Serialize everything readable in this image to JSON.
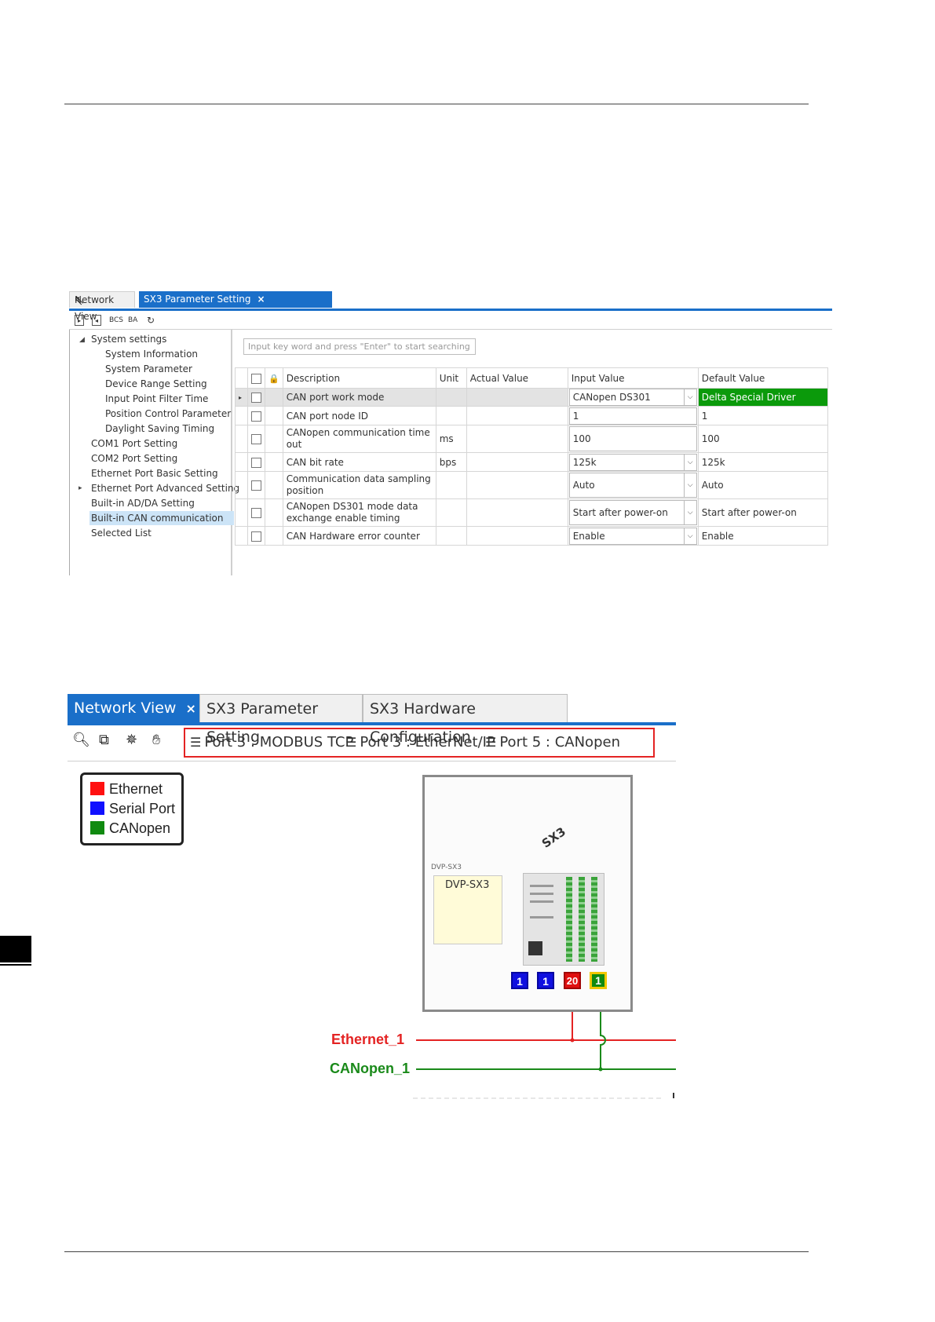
{
  "screenshot1": {
    "tabs": [
      {
        "label": "Network View"
      },
      {
        "label": "SX3 Parameter Setting",
        "close": "×"
      }
    ],
    "toolbar_icons": [
      "import-icon",
      "export-icon",
      "bcs-icon",
      "ba-icon",
      "refresh-icon"
    ],
    "toolbar_text": {
      "bcs": "BCS",
      "ba": "BA"
    },
    "tree": {
      "root": "System settings",
      "children": [
        "System Information",
        "System Parameter",
        "Device Range Setting",
        "Input Point Filter Time",
        "Position Control Parameter",
        "Daylight Saving Timing"
      ],
      "items": [
        "COM1 Port Setting",
        "COM2 Port Setting",
        "Ethernet Port Basic Setting",
        "Ethernet Port Advanced Setting",
        "Built-in AD/DA Setting",
        "Built-in CAN communication",
        "Selected List"
      ],
      "selected": "Built-in CAN communication"
    },
    "search": {
      "placeholder": "Input key word and press \"Enter\" to start searching"
    },
    "columns": {
      "description": "Description",
      "unit": "Unit",
      "actual": "Actual Value",
      "input": "Input Value",
      "default": "Default Value"
    },
    "rows": [
      {
        "desc": "CAN port work mode",
        "unit": "",
        "input": "CANopen DS301",
        "dropdown": true,
        "default": "Delta Special Driver"
      },
      {
        "desc": "CAN port node ID",
        "unit": "",
        "input": "1",
        "dropdown": false,
        "default": "1"
      },
      {
        "desc": "CANopen communication time out",
        "unit": "ms",
        "input": "100",
        "dropdown": false,
        "default": "100"
      },
      {
        "desc": "CAN bit rate",
        "unit": "bps",
        "input": "125k",
        "dropdown": true,
        "default": "125k"
      },
      {
        "desc": "Communication data sampling position",
        "unit": "",
        "input": "Auto",
        "dropdown": true,
        "default": "Auto"
      },
      {
        "desc": "CANopen DS301 mode data exchange enable timing",
        "unit": "",
        "input": "Start after power-on",
        "dropdown": true,
        "default": "Start after power-on"
      },
      {
        "desc": "CAN Hardware error counter",
        "unit": "",
        "input": "Enable",
        "dropdown": true,
        "default": "Enable"
      }
    ],
    "colors": {
      "accent": "#1a6fc9",
      "default_highlight": "#0b9a0b"
    }
  },
  "screenshot2": {
    "tabs": [
      {
        "label": "Network View",
        "close": "×"
      },
      {
        "label": "SX3 Parameter Setting"
      },
      {
        "label": "SX3 Hardware Configuration"
      }
    ],
    "toolbar_icons": [
      "zoom-fit-icon",
      "zoom-select-icon",
      "network-icon",
      "hand-icon"
    ],
    "ports": [
      "Port 3 : MODBUS TCP",
      "Port 3 : EtherNet/IP",
      "Port 5 : CANopen"
    ],
    "legend": [
      {
        "label": "Ethernet",
        "color": "#ff1010"
      },
      {
        "label": "Serial Port",
        "color": "#1010ff"
      },
      {
        "label": "CANopen",
        "color": "#108a10"
      }
    ],
    "device": {
      "rotated_label": "SX3",
      "small_label": "DVP-SX3",
      "module_label": "DVP-SX3"
    },
    "port_badges": [
      {
        "label": "1",
        "color": "#1010e0"
      },
      {
        "label": "1",
        "color": "#1010e0"
      },
      {
        "label": "20",
        "color": "#e01010"
      },
      {
        "label": "1",
        "color": "#108a10"
      }
    ],
    "networks": [
      {
        "label": "Ethernet_1",
        "color": "#e42323"
      },
      {
        "label": "CANopen_1",
        "color": "#1a8a1a"
      }
    ]
  }
}
